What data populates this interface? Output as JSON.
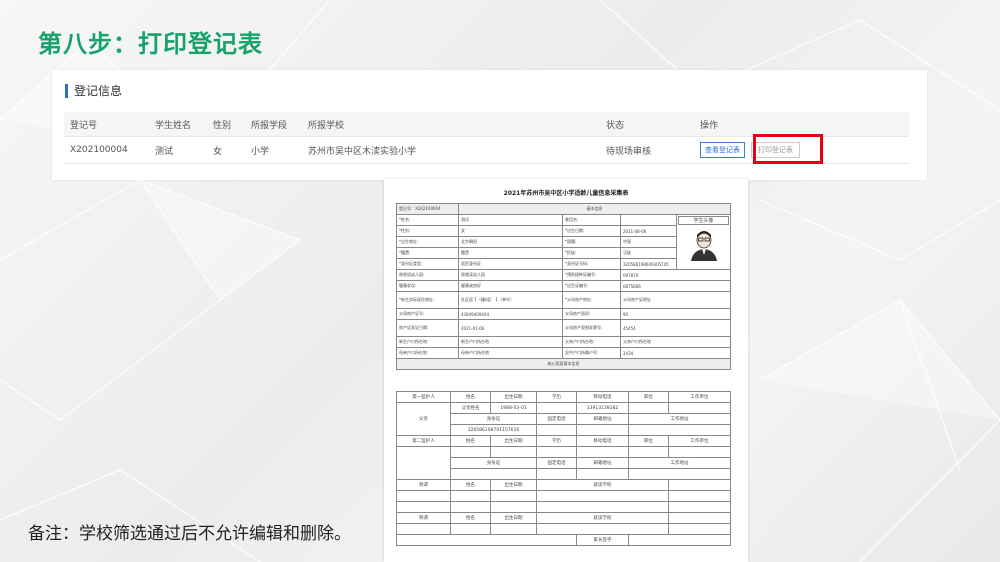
{
  "slide_title": "第八步：打印登记表",
  "panel": {
    "heading": "登记信息",
    "columns": [
      "登记号",
      "学生姓名",
      "性别",
      "所报学段",
      "所报学校",
      "状态",
      "操作"
    ],
    "row": {
      "reg_no": "X202100004",
      "name": "测试",
      "gender": "女",
      "stage": "小学",
      "school": "苏州市吴中区木渎实验小学",
      "status": "待现场审核",
      "btn_view": "查看登记表",
      "btn_print": "打印登记表"
    }
  },
  "form": {
    "title": "2021年苏州市吴中区小学适龄儿童信息采集表",
    "reg_line": "登记号：X202100004",
    "section_basic": "基本信息",
    "photo_label": "学生头像",
    "basic_rows": [
      [
        "*姓名:",
        "测试",
        "曾用名:",
        ""
      ],
      [
        "*性别:",
        "女",
        "*出生日期:",
        "2011-08-06"
      ],
      [
        "*出生地址:",
        "北京朝阳",
        "*国籍:",
        "中国"
      ],
      [
        "*籍贯:",
        "籍贯",
        "*民族:",
        "汉族"
      ],
      [
        "*身份证类型:",
        "居民身份证",
        "*身份证号码:",
        "320586198609305745"
      ],
      [
        "原就读幼儿园:",
        "原就读幼儿园",
        "*预防接种证编号:",
        "097876"
      ],
      [
        "健康状况:",
        "健康或良好",
        "*出生证编号:",
        "0875866"
      ],
      [
        "*新生实际居住地址:",
        "社区居 1（幢/组） 1（单号）",
        "*父母房产地址:",
        "父母房产证地址"
      ],
      [
        "父母房产证号:",
        "43849409444",
        "父母房产面积:",
        "90"
      ],
      [
        "房产证发证日期:",
        "2021-01-06",
        "父母房产契税发票号:",
        "45454"
      ],
      [
        "新生户口所在地:",
        "新生户口所在地",
        "父亲户口所在地:",
        "父亲户口所在地"
      ],
      [
        "母亲户口所在地:",
        "母亲户口所在地",
        "吴中户口所属户号:",
        "2434"
      ]
    ],
    "section_family": "核心家庭基本信息",
    "guardian_header": [
      "第一监护人",
      "姓名",
      "出生日期",
      "学历",
      "移动电话",
      "职位",
      "工作单位"
    ],
    "father_label": "父亲",
    "father_name": "父亲姓名",
    "father_birth": "1988-03-01",
    "father_phone": "13913139282",
    "id_label": "身份证",
    "fixed_phone_label": "固定电话",
    "email_label": "邮箱地址",
    "work_addr_label": "工作地址",
    "father_id": "320586198701157616",
    "guardian2_header": [
      "第二监护人",
      "姓名",
      "出生日期",
      "学历",
      "移动电话",
      "职位",
      "工作单位"
    ],
    "sibling_header": [
      "称谓",
      "姓名",
      "出生日期",
      "就读学校"
    ],
    "parent_sign": "家长签字"
  },
  "note": "备注：学校筛选通过后不允许编辑和删除。"
}
